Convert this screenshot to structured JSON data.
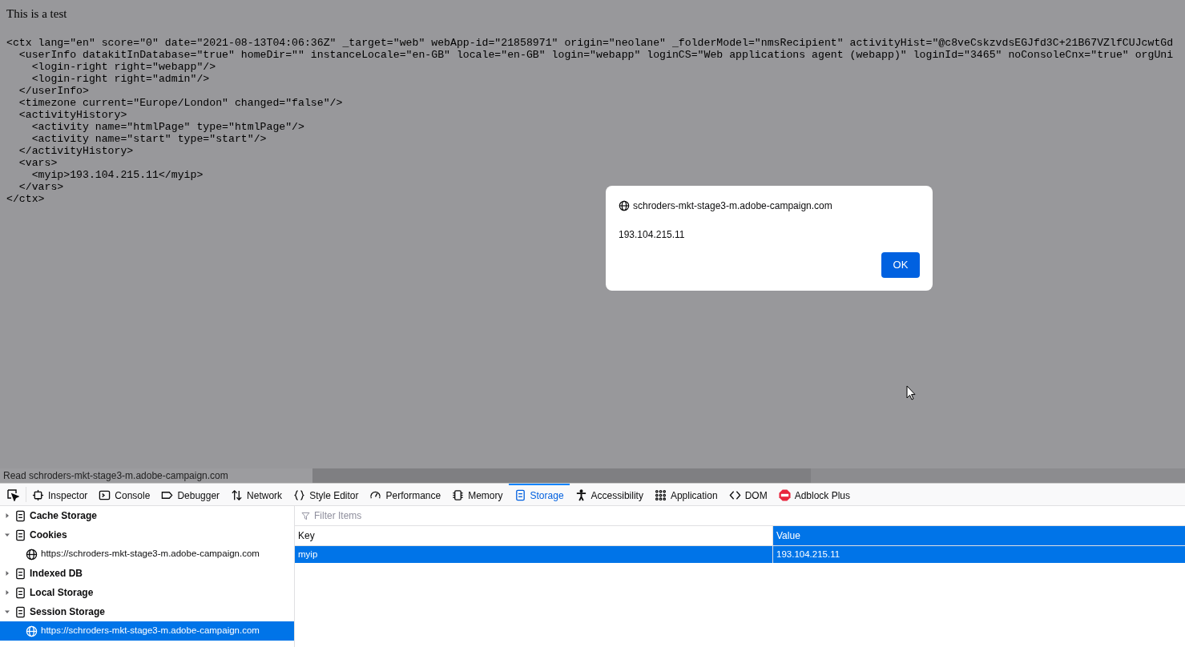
{
  "page": {
    "heading": "This is a test",
    "code_lines": [
      "<ctx lang=\"en\" score=\"0\" date=\"2021-08-13T04:06:36Z\" _target=\"web\" webApp-id=\"21858971\" origin=\"neolane\" _folderModel=\"nmsRecipient\" activityHist=\"@c8veCskzvdsEGJfd3C+21B67VZlfCUJcwtGd",
      "  <userInfo datakitInDatabase=\"true\" homeDir=\"\" instanceLocale=\"en-GB\" locale=\"en-GB\" login=\"webapp\" loginCS=\"Web applications agent (webapp)\" loginId=\"3465\" noConsoleCnx=\"true\" orgUni",
      "    <login-right right=\"webapp\"/>",
      "    <login-right right=\"admin\"/>",
      "  </userInfo>",
      "  <timezone current=\"Europe/London\" changed=\"false\"/>",
      "  <activityHistory>",
      "    <activity name=\"htmlPage\" type=\"htmlPage\"/>",
      "    <activity name=\"start\" type=\"start\"/>",
      "  </activityHistory>",
      "  <vars>",
      "    <myip>193.104.215.11</myip>",
      "  </vars>",
      "</ctx>"
    ]
  },
  "dialog": {
    "origin": "schroders-mkt-stage3-m.adobe-campaign.com",
    "message": "193.104.215.11",
    "buttons": [
      {
        "label": "OK"
      }
    ]
  },
  "status_text": "Read schroders-mkt-stage3-m.adobe-campaign.com",
  "devtools": {
    "tabs": [
      {
        "kind": "inspector",
        "label": "Inspector",
        "selected": false
      },
      {
        "kind": "console",
        "label": "Console",
        "selected": false
      },
      {
        "kind": "debugger",
        "label": "Debugger",
        "selected": false
      },
      {
        "kind": "network",
        "label": "Network",
        "selected": false
      },
      {
        "kind": "style",
        "label": "Style Editor",
        "selected": false
      },
      {
        "kind": "performance",
        "label": "Performance",
        "selected": false
      },
      {
        "kind": "memory",
        "label": "Memory",
        "selected": false
      },
      {
        "kind": "storage",
        "label": "Storage",
        "selected": true
      },
      {
        "kind": "accessibility",
        "label": "Accessibility",
        "selected": false
      },
      {
        "kind": "application",
        "label": "Application",
        "selected": false
      },
      {
        "kind": "dom",
        "label": "DOM",
        "selected": false
      },
      {
        "kind": "adblock",
        "label": "Adblock Plus",
        "selected": false
      }
    ],
    "tree": [
      {
        "label": "Cache Storage",
        "expanded": false
      },
      {
        "label": "Cookies",
        "expanded": true,
        "children": [
          {
            "label": "https://schroders-mkt-stage3-m.adobe-campaign.com",
            "selected": false
          }
        ]
      },
      {
        "label": "Indexed DB",
        "expanded": false
      },
      {
        "label": "Local Storage",
        "expanded": false
      },
      {
        "label": "Session Storage",
        "expanded": true,
        "children": [
          {
            "label": "https://schroders-mkt-stage3-m.adobe-campaign.com",
            "selected": true
          }
        ]
      }
    ],
    "filter": {
      "placeholder": "Filter Items"
    },
    "table": {
      "columns": [
        {
          "label": "Key",
          "selected": false
        },
        {
          "label": "Value",
          "selected": true
        }
      ],
      "rows": [
        {
          "cells": [
            "myip",
            "193.104.215.11"
          ],
          "selected": true
        }
      ]
    }
  }
}
